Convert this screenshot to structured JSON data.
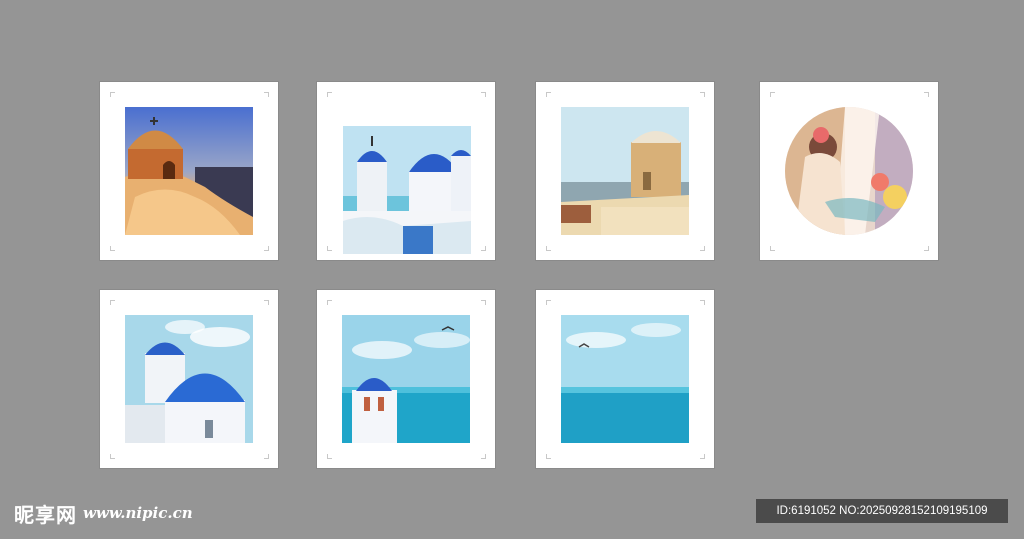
{
  "watermark": {
    "site_name": "昵享网",
    "site_url": "www.nipic.cn",
    "id_text": "ID:6191052 NO:20250928152109195109"
  },
  "colors": {
    "background": "#959595",
    "frame": "#ffffff",
    "sea": "#1fa5c9",
    "dome_blue": "#2460c8"
  },
  "frames": [
    {
      "name": "sunset-church-print"
    },
    {
      "name": "blue-domes-church-print"
    },
    {
      "name": "windmill-print"
    },
    {
      "name": "girl-watercolor-circle-print"
    },
    {
      "name": "white-blue-dome-print"
    },
    {
      "name": "bell-tower-sea-print"
    },
    {
      "name": "seagull-sea-print"
    }
  ]
}
